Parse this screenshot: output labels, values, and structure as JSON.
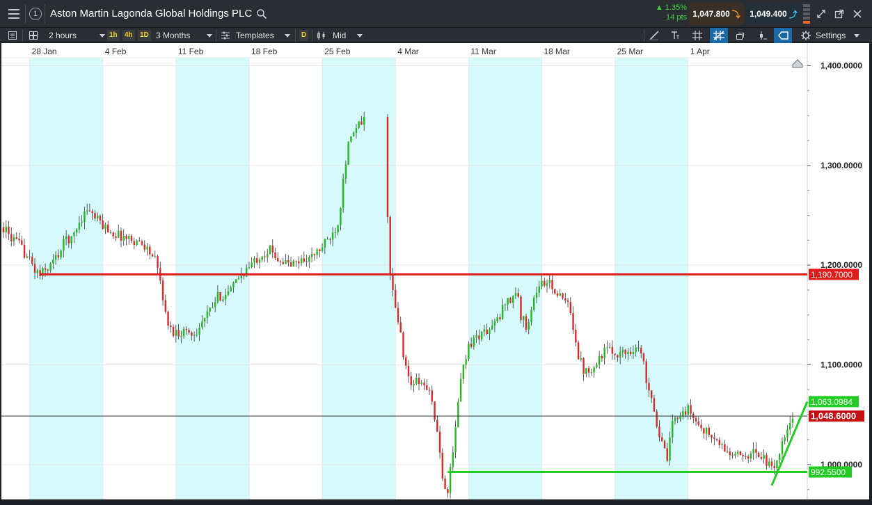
{
  "header": {
    "title": "Aston Martin Lagonda Global Holdings PLC",
    "change_pct": "▲ 1.35%",
    "change_pts": "14 pts",
    "sell_price": "1,047.800",
    "buy_price": "1,049.400"
  },
  "toolbar": {
    "interval": "2 hours",
    "tf_1h": "1h",
    "tf_4h": "4h",
    "tf_1d": "1D",
    "range": "3 Months",
    "templates": "Templates",
    "d_badge": "D",
    "price_type": "Mid",
    "settings": "Settings"
  },
  "colors": {
    "up": "#22b822",
    "down": "#d42a2a",
    "resistance": "#e01b1b",
    "support": "#22cc22",
    "weekend_band": "#d6f9fb",
    "current_badge": "#c41010"
  },
  "icons": [
    "hamburger-icon",
    "search-icon",
    "grid-icon",
    "crosshair-icon",
    "settings-icon",
    "popout-icon",
    "close-icon",
    "home-icon"
  ],
  "chart_data": {
    "type": "candlestick",
    "x_ticks": [
      "28 Jan",
      "4 Feb",
      "11 Feb",
      "18 Feb",
      "25 Feb",
      "4 Mar",
      "11 Mar",
      "18 Mar",
      "25 Mar",
      "1 Apr"
    ],
    "x_tick_days": [
      27,
      34,
      41,
      48,
      55,
      62,
      69,
      76,
      83,
      90
    ],
    "y_ticks": [
      "1,400.0000",
      "1,300.0000",
      "1,200.0000",
      "1,100.0000",
      "1,000.0000"
    ],
    "y_tick_values": [
      1400,
      1300,
      1200,
      1100,
      1000
    ],
    "xlim": [
      24.3,
      101.4
    ],
    "ylim": [
      965,
      1408
    ],
    "weekend_bands": [
      [
        27,
        34
      ],
      [
        41,
        48
      ],
      [
        55,
        62
      ],
      [
        69,
        76
      ],
      [
        83,
        90
      ]
    ],
    "anchors": [
      [
        24.5,
        1238
      ],
      [
        25,
        1230
      ],
      [
        26,
        1220
      ],
      [
        27,
        1205
      ],
      [
        27.5,
        1195
      ],
      [
        28,
        1190
      ],
      [
        29,
        1200
      ],
      [
        30,
        1215
      ],
      [
        30.5,
        1228
      ],
      [
        31,
        1225
      ],
      [
        31.5,
        1238
      ],
      [
        32,
        1248
      ],
      [
        32.6,
        1258
      ],
      [
        33,
        1250
      ],
      [
        34,
        1240
      ],
      [
        35,
        1232
      ],
      [
        36,
        1228
      ],
      [
        37,
        1225
      ],
      [
        38,
        1220
      ],
      [
        39,
        1205
      ],
      [
        39.6,
        1180
      ],
      [
        40,
        1150
      ],
      [
        40.5,
        1135
      ],
      [
        41.2,
        1132
      ],
      [
        42,
        1135
      ],
      [
        42.5,
        1130
      ],
      [
        43,
        1135
      ],
      [
        44,
        1150
      ],
      [
        44.6,
        1160
      ],
      [
        45,
        1168
      ],
      [
        46,
        1172
      ],
      [
        46.5,
        1178
      ],
      [
        47,
        1188
      ],
      [
        48,
        1198
      ],
      [
        48.6,
        1205
      ],
      [
        49,
        1210
      ],
      [
        50,
        1215
      ],
      [
        51,
        1205
      ],
      [
        52,
        1200
      ],
      [
        53,
        1205
      ],
      [
        54,
        1208
      ],
      [
        55,
        1218
      ],
      [
        55.5,
        1225
      ],
      [
        56,
        1232
      ],
      [
        56.6,
        1245
      ],
      [
        57,
        1290
      ],
      [
        57.5,
        1320
      ],
      [
        58,
        1332
      ],
      [
        58.5,
        1340
      ],
      [
        59,
        1345
      ],
      [
        61.2,
        1260
      ],
      [
        61.5,
        1190
      ],
      [
        62,
        1155
      ],
      [
        62.5,
        1130
      ],
      [
        63,
        1095
      ],
      [
        63.5,
        1080
      ],
      [
        64,
        1083
      ],
      [
        65,
        1078
      ],
      [
        65.6,
        1060
      ],
      [
        66,
        1030
      ],
      [
        66.5,
        985
      ],
      [
        67,
        975
      ],
      [
        67.5,
        1010
      ],
      [
        68,
        1065
      ],
      [
        68.5,
        1100
      ],
      [
        69,
        1120
      ],
      [
        70,
        1130
      ],
      [
        71,
        1135
      ],
      [
        72,
        1148
      ],
      [
        72.5,
        1165
      ],
      [
        73,
        1165
      ],
      [
        73.6,
        1175
      ],
      [
        74,
        1148
      ],
      [
        74.5,
        1140
      ],
      [
        75,
        1155
      ],
      [
        75.5,
        1175
      ],
      [
        76,
        1182
      ],
      [
        77,
        1180
      ],
      [
        77.5,
        1170
      ],
      [
        78.5,
        1160
      ],
      [
        79,
        1140
      ],
      [
        79.5,
        1110
      ],
      [
        80,
        1095
      ],
      [
        81,
        1098
      ],
      [
        82,
        1115
      ],
      [
        83,
        1112
      ],
      [
        84,
        1112
      ],
      [
        85,
        1118
      ],
      [
        85.6,
        1110
      ],
      [
        86,
        1085
      ],
      [
        86.5,
        1070
      ],
      [
        87,
        1040
      ],
      [
        87.5,
        1020
      ],
      [
        88,
        1005
      ],
      [
        88.5,
        1040
      ],
      [
        89,
        1050
      ],
      [
        90,
        1055
      ],
      [
        91,
        1040
      ],
      [
        92,
        1030
      ],
      [
        93,
        1020
      ],
      [
        94,
        1010
      ],
      [
        95,
        1008
      ],
      [
        96,
        1012
      ],
      [
        97,
        1010
      ],
      [
        97.5,
        1002
      ],
      [
        98,
        995
      ],
      [
        98.5,
        1005
      ],
      [
        99,
        1020
      ],
      [
        99.5,
        1033
      ],
      [
        100,
        1045
      ],
      [
        100.1,
        1049
      ]
    ],
    "gap_start": 59.2,
    "gap_end": 61.1,
    "lines": [
      {
        "from": [
          28,
          1190.7
        ],
        "to": [
          101.4,
          1190.7
        ],
        "kind": "resistance"
      },
      {
        "from": [
          67,
          992.55
        ],
        "to": [
          101.4,
          992.55
        ],
        "kind": "support"
      },
      {
        "from": [
          98,
          979
        ],
        "to": [
          101.4,
          1063.1
        ],
        "kind": "support"
      }
    ],
    "current_price": 1048.6,
    "price_badges": [
      {
        "label": "1,190.7000",
        "value": 1190.7,
        "kind": "resistance"
      },
      {
        "label": "1,063.0984",
        "value": 1063.1,
        "kind": "support_outline"
      },
      {
        "label": "1,048.6000",
        "value": 1048.6,
        "kind": "current"
      },
      {
        "label": "992.5500",
        "value": 992.55,
        "kind": "support"
      }
    ]
  }
}
